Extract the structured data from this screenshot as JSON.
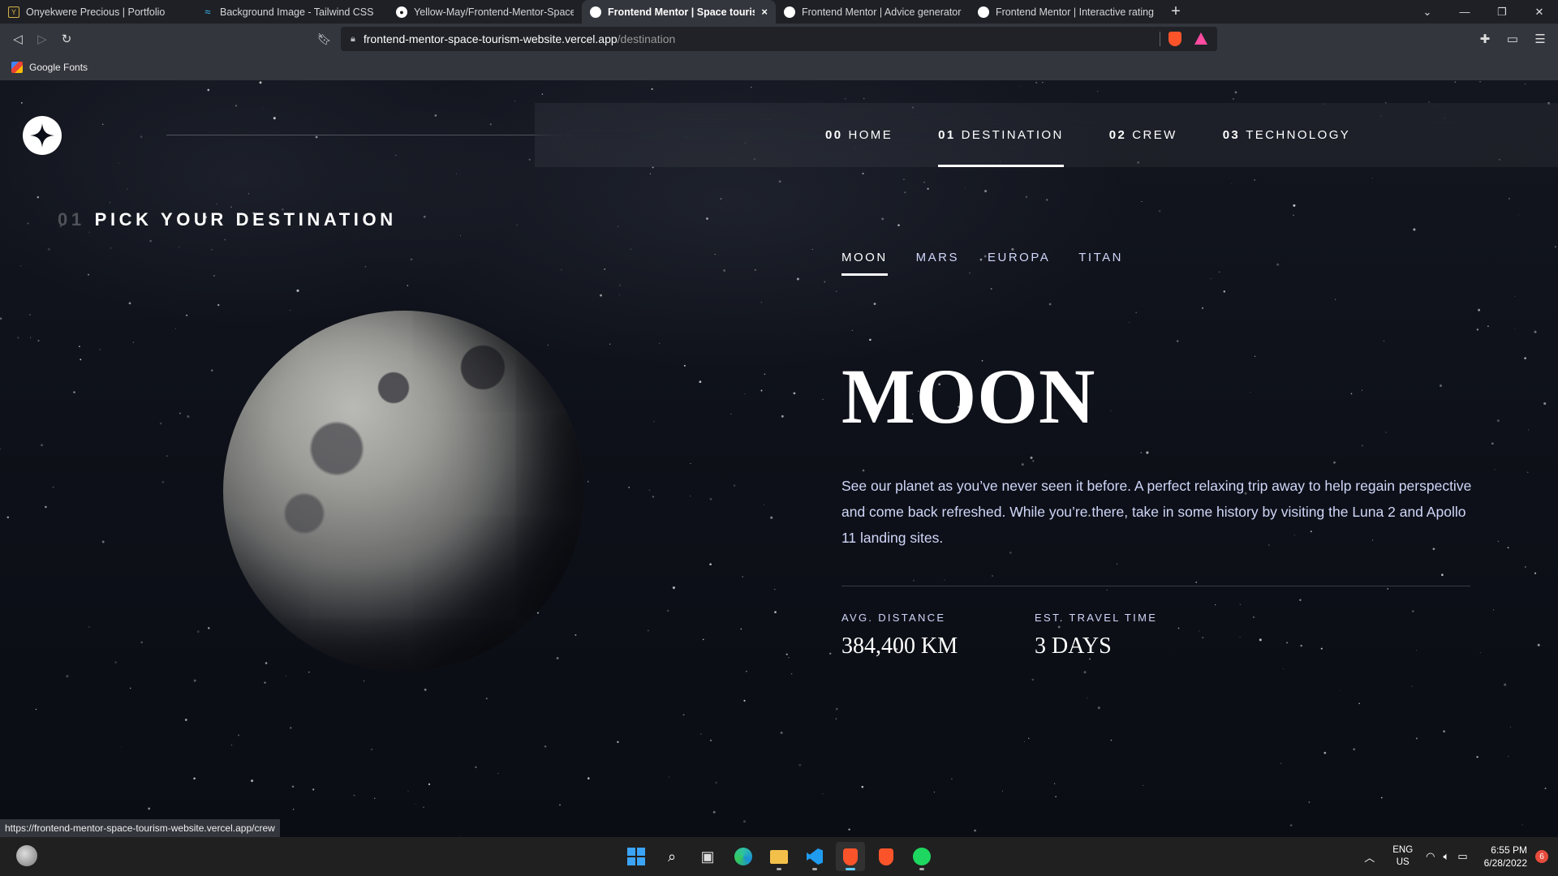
{
  "browser": {
    "tabs": [
      {
        "title": "Onyekwere Precious | Portfolio",
        "icon": "portfolio-favicon-icon",
        "active": false
      },
      {
        "title": "Background Image - Tailwind CSS",
        "icon": "tailwind-favicon-icon",
        "active": false
      },
      {
        "title": "Yellow-May/Frontend-Mentor-Space-t",
        "icon": "github-favicon-icon",
        "active": false
      },
      {
        "title": "Frontend Mentor | Space tourism",
        "icon": "globe-favicon-icon",
        "active": true,
        "close": "×"
      },
      {
        "title": "Frontend Mentor | Advice generator a",
        "icon": "globe-favicon-icon",
        "active": false
      },
      {
        "title": "Frontend Mentor | Interactive rating c",
        "icon": "globe-favicon-icon",
        "active": false
      }
    ],
    "new_tab": "+",
    "url_host": "frontend-mentor-space-tourism-website.vercel.app",
    "url_path": "/destination",
    "bookmarks": [
      {
        "label": "Google Fonts"
      }
    ],
    "status_url": "https://frontend-mentor-space-tourism-website.vercel.app/crew"
  },
  "nav": {
    "items": [
      {
        "num": "00",
        "label": "HOME",
        "active": false
      },
      {
        "num": "01",
        "label": "DESTINATION",
        "active": true
      },
      {
        "num": "02",
        "label": "CREW",
        "active": false
      },
      {
        "num": "03",
        "label": "TECHNOLOGY",
        "active": false
      }
    ]
  },
  "heading": {
    "num": "01",
    "text": "PICK YOUR DESTINATION"
  },
  "destinations": {
    "tabs": [
      {
        "label": "MOON",
        "active": true
      },
      {
        "label": "MARS",
        "active": false
      },
      {
        "label": "EUROPA",
        "active": false
      },
      {
        "label": "TITAN",
        "active": false
      }
    ],
    "name": "MOON",
    "description": "See our planet as you’ve never seen it before. A perfect relaxing trip away to help regain perspective and come back refreshed. While you’re there, take in some history by visiting the Luna 2 and Apollo 11 landing sites.",
    "stats": [
      {
        "label": "AVG. DISTANCE",
        "value": "384,400 KM"
      },
      {
        "label": "EST. TRAVEL TIME",
        "value": "3 DAYS"
      }
    ]
  },
  "taskbar": {
    "apps": [
      "windows-start-icon",
      "search-icon",
      "task-view-icon",
      "edge-icon",
      "file-explorer-icon",
      "vscode-icon",
      "brave-icon",
      "brave-icon",
      "spotify-icon"
    ],
    "lang": "ENG",
    "region": "US",
    "time": "6:55 PM",
    "date": "6/28/2022",
    "notifications": "6"
  },
  "colors": {
    "page_bg": "#0b0d17",
    "accent_text": "#d0d6f9",
    "chrome_bg": "#33363d",
    "tab_bg": "#1e2026",
    "taskbar_bg": "#202020"
  }
}
